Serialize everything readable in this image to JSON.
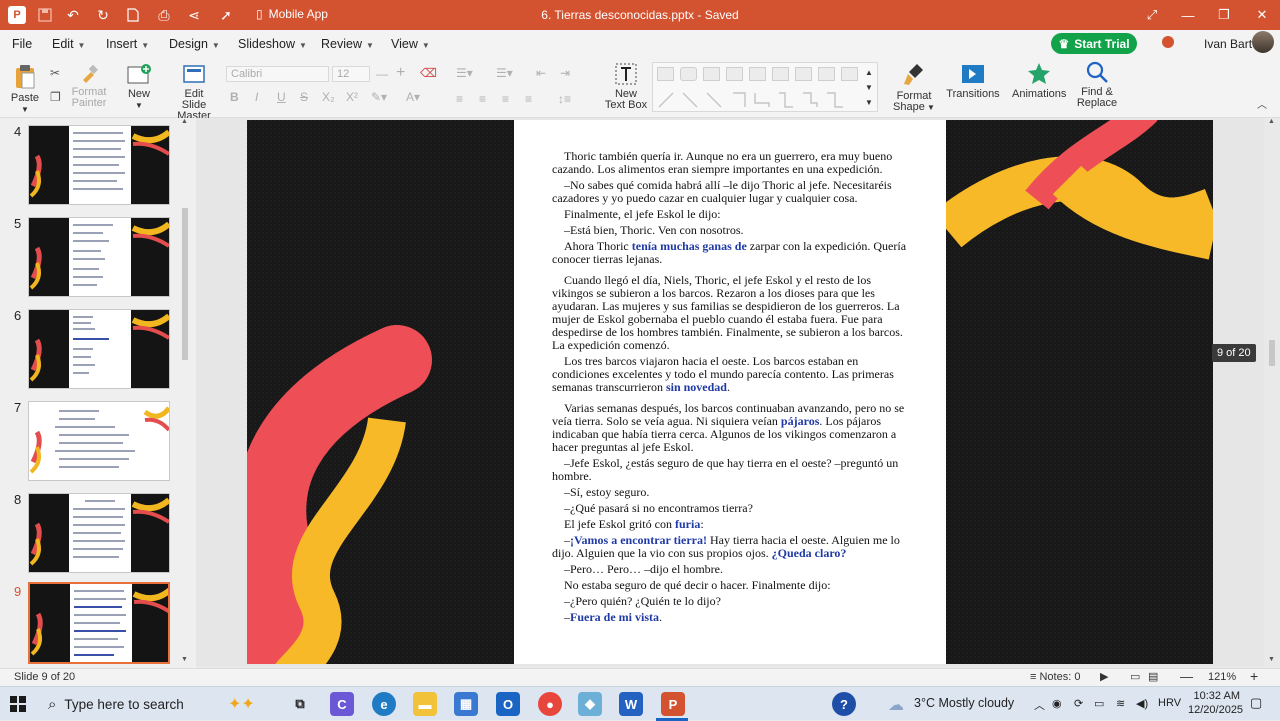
{
  "titlebar": {
    "title": "6. Tierras desconocidas.pptx - Saved",
    "mobile_app": "Mobile App",
    "color": "#d35230"
  },
  "menu": {
    "items": [
      "File",
      "Edit",
      "Insert",
      "Design",
      "Slideshow",
      "Review",
      "View"
    ],
    "start_trial": "Start Trial",
    "user_name": "Ivan Bart"
  },
  "ribbon": {
    "paste": "Paste",
    "format_painter": "Format Painter",
    "new": "New",
    "edit_slide_master": "Edit Slide Master",
    "font_name": "Calibri",
    "font_size": "12",
    "new_text_box": "New Text Box",
    "format_shape": "Format Shape",
    "transitions": "Transitions",
    "animations": "Animations",
    "find_replace": "Find & Replace"
  },
  "slides_panel": {
    "numbers": [
      "4",
      "5",
      "6",
      "7",
      "8",
      "9"
    ],
    "selected": "9"
  },
  "document": {
    "p1": "Thoric también quería ir. Aunque no era un guerrero, era muy bueno cazando. Los alimentos eran siempre importantes en una expedición.",
    "p2": "–No sabes qué comida habrá allí –le dijo Thoric al jefe. Necesitaréis cazadores y yo puedo cazar en cualquier lugar y cualquier cosa.",
    "p3": "Finalmente, el jefe Eskol le dijo:",
    "p4": "–Está bien, Thoric. Ven con nosotros.",
    "p5a": "Ahora Thoric ",
    "p5b": "tenía muchas ganas de",
    "p5c": " zarpar con la expedición. Quería conocer tierras lejanas.",
    "p6": "Cuando llegó el día, Niels, Thoric, el jefe Eskol y el resto de los vikingos se subieron a los barcos. Rezaron a los dioses para que les ayudaran. Las mujeres y sus familias se despidieron de los guerreros. La mujer de Eskol gobernaba el pueblo cuando él estaba fuera. Fue para despedirse de los hombres también. Finalmente, se subieron a los barcos. La expedición comenzó.",
    "p7a": "Los tres barcos viajaron hacia el oeste. Los barcos estaban en condiciones excelentes y todo el mundo parecía contento. Las primeras semanas transcurrieron ",
    "p7b": "sin novedad",
    "p7c": ".",
    "p8a": "Varias semanas después, los barcos continuaban avanzando, pero no se veía tierra. Solo se veía agua. Ni siquiera veían ",
    "p8b": "pájaros",
    "p8c": ". Los pájaros indicaban que había tierra cerca. Algunos de los vikingos comenzaron a hacer preguntas al jefe Eskol.",
    "p9": "–Jefe Eskol, ¿estás seguro de que hay tierra en el oeste? –preguntó un hombre.",
    "p10": "–Sí, estoy seguro.",
    "p11": "–¿Qué pasará si no encontramos tierra?",
    "p12a": "El jefe Eskol gritó con ",
    "p12b": "furia",
    "p12c": ":",
    "p13a": "–",
    "p13b": "¡Vamos a encontrar tierra!",
    "p13c": " Hay tierra hacia el oeste. Alguien me lo dijo. Alguien que la vio con sus propios ojos. ",
    "p13d": "¿Queda claro?",
    "p14": "–Pero… Pero… –dijo el hombre.",
    "p15": "No estaba seguro de qué decir o hacer. Finalmente dijo:",
    "p16": "–¿Pero quién? ¿Quién te lo dijo?",
    "p17a": "–",
    "p17b": "Fuera de mi vista",
    "p17c": "."
  },
  "page_indicator": "9 of 20",
  "status": {
    "slide": "Slide 9 of 20",
    "notes": "Notes: 0",
    "zoom": "121%"
  },
  "taskbar": {
    "search": "Type here to search",
    "weather": "3°C  Mostly cloudy",
    "lang": "HRV",
    "time": "10:32 AM",
    "date": "12/20/2025"
  }
}
